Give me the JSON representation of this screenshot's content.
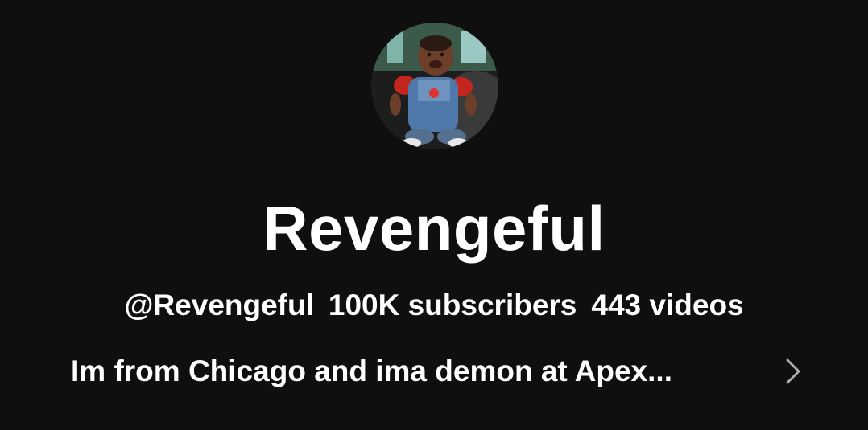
{
  "channel": {
    "name": "Revengeful",
    "handle": "@Revengeful",
    "subscribers": "100K subscribers",
    "videos": "443 videos",
    "description": "Im from Chicago and ima demon at Apex..."
  },
  "colors": {
    "background": "#0f0f0f",
    "text": "#ffffff",
    "chevron": "#aaaaaa"
  },
  "icons": {
    "avatar": "channel-avatar-photo",
    "more": "chevron-right-icon"
  }
}
